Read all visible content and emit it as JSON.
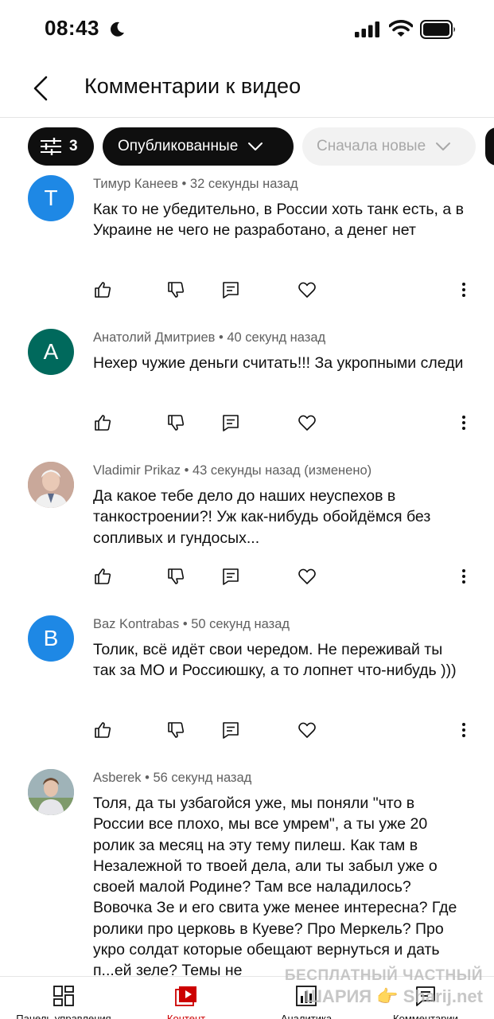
{
  "status_bar": {
    "time": "08:43"
  },
  "header": {
    "title": "Комментарии к видео"
  },
  "filters": {
    "filter_count": "3",
    "status_label": "Опубликованные",
    "sort_label": "Сначала новые"
  },
  "comments": [
    {
      "author": "Тимур Канеев",
      "time": "32 секунды назад",
      "avatar_letter": "Т",
      "avatar_color": "#1e88e5",
      "text": "Как то не убедительно, в России хоть танк есть, а в Украине не чего не разработано, а денег нет"
    },
    {
      "author": "Анатолий Дмитриев",
      "time": "40 секунд назад",
      "avatar_letter": "А",
      "avatar_color": "#00695c",
      "text": "Нехер чужие деньги считать!!! За укропными следи"
    },
    {
      "author": "Vladimir Prikaz",
      "time": "43 секунды назад (изменено)",
      "avatar_letter": "",
      "avatar_color": "#b79a86",
      "text": "Да какое тебе дело до наших неуспехов в танкостроении?! Уж как-нибудь обойдёмся без сопливых и гундосых..."
    },
    {
      "author": "Baz Kontrabas",
      "time": "50 секунд назад",
      "avatar_letter": "B",
      "avatar_color": "#1e88e5",
      "text": "Толик, всё идёт свои чередом. Не переживай ты так за МО и Россиюшку, а то лопнет что-нибудь )))"
    },
    {
      "author": "Asberek",
      "time": "56 секунд назад",
      "avatar_letter": "",
      "avatar_color": "#8fa3a8",
      "text": "Толя, да ты узбагойся уже, мы поняли \"что в России все плохо, мы все умрем\", а ты уже 20 ролик за месяц на эту тему пилеш. Как там в Незалежной то твоей дела, али ты забыл уже о своей малой Родине? Там все наладилось? Вовочка Зе и его свита уже менее интересна? Где ролики про церковь в Куеве? Про Меркель? Про укро солдат которые обещают вернуться и дать п...ей зеле? Темы не"
    }
  ],
  "tabs": [
    {
      "label": "Панель управления",
      "icon": "dashboard-icon"
    },
    {
      "label": "Контент",
      "icon": "content-icon",
      "active": true
    },
    {
      "label": "Аналитика",
      "icon": "analytics-icon"
    },
    {
      "label": "Комментарии",
      "icon": "comments-icon"
    }
  ],
  "watermark": {
    "line1": "БЕСПЛАТНЫЙ ЧАСТНЫЙ",
    "line2": "ШАРИЯ 👉 Sharij.net"
  },
  "colors": {
    "accent": "#cc0000",
    "dark_chip": "#0f0f0f",
    "light_chip": "#f2f2f2"
  }
}
